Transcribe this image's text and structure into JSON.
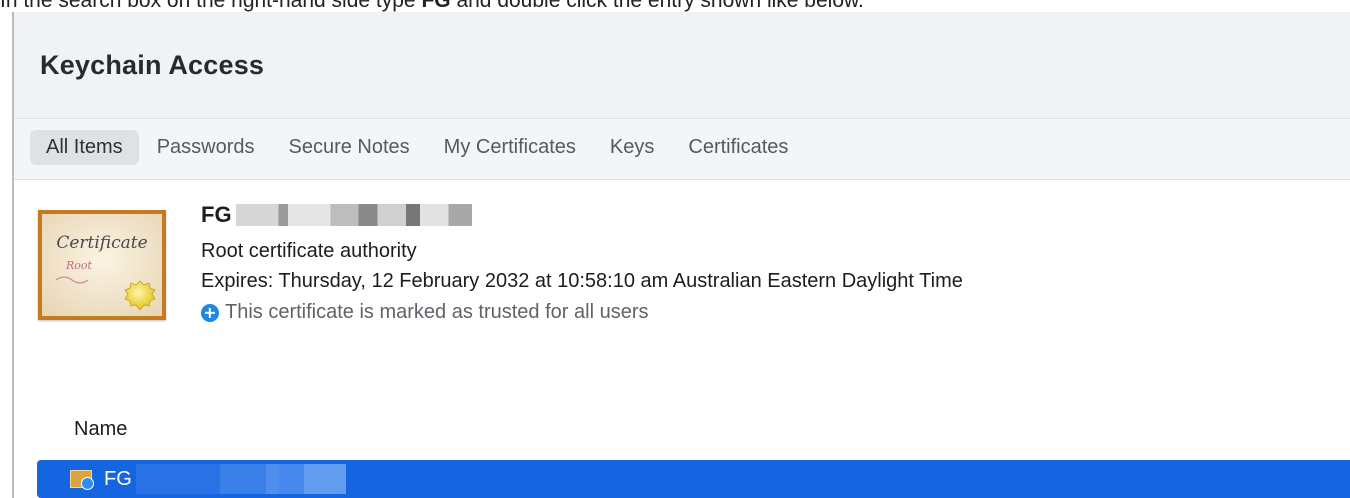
{
  "instruction": {
    "prefix": "In the search box on the right-hand side type ",
    "keyword": "FG",
    "suffix": " and double click the entry shown like below."
  },
  "window": {
    "title": "Keychain Access"
  },
  "tabs": [
    {
      "label": "All Items",
      "active": true
    },
    {
      "label": "Passwords",
      "active": false
    },
    {
      "label": "Secure Notes",
      "active": false
    },
    {
      "label": "My Certificates",
      "active": false
    },
    {
      "label": "Keys",
      "active": false
    },
    {
      "label": "Certificates",
      "active": false
    }
  ],
  "certificate": {
    "icon": "certificate-icon",
    "icon_text_main": "Certificate",
    "icon_text_sub": "Root",
    "name": "FG",
    "type": "Root certificate authority",
    "expires": "Expires: Thursday, 12 February 2032 at 10:58:10 am Australian Eastern Daylight Time",
    "trust_icon": "plus-circle-icon",
    "trust_text": "This certificate is marked as trusted for all users"
  },
  "list": {
    "column_header": "Name",
    "rows": [
      {
        "name": "FG",
        "icon": "certificate-small-icon",
        "selected": true
      }
    ]
  },
  "colors": {
    "selection": "#1565e0",
    "trust_icon": "#1e88e5",
    "cert_frame": "#c67a1e"
  }
}
